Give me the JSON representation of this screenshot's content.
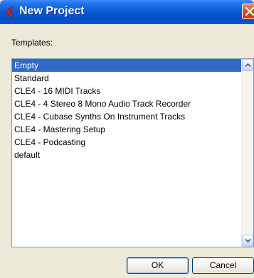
{
  "window": {
    "title": "New Project"
  },
  "templates_label": "Templates:",
  "templates": {
    "items": [
      "Empty",
      "Standard",
      "CLE4 - 16 MIDI Tracks",
      "CLE4 - 4 Stereo 8 Mono Audio Track Recorder",
      "CLE4 - Cubase Synths On Instrument Tracks",
      "CLE4 - Mastering Setup",
      "CLE4 - Podcasting",
      "default"
    ],
    "selected": "Empty"
  },
  "buttons": {
    "ok_label": "OK",
    "cancel_label": "Cancel"
  },
  "colors": {
    "titlebar": "#0a58d6",
    "selection": "#316ac5",
    "dialog_bg": "#ece9d8",
    "close_button": "#d6502e"
  },
  "icons": {
    "app": "cubase-arrow-icon",
    "close": "close-icon",
    "scroll_up": "chevron-up-icon",
    "scroll_down": "chevron-down-icon"
  }
}
